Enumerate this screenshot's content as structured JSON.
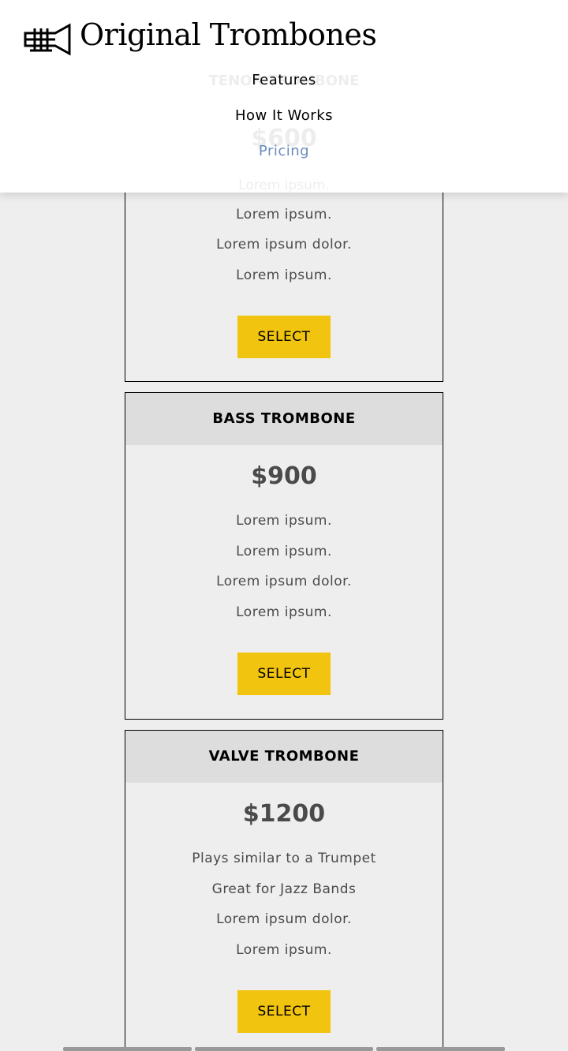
{
  "brand": {
    "name": "Original Trombones",
    "logo_icon": "trumpet-logo-icon"
  },
  "nav": {
    "items": [
      {
        "label": "Features",
        "active": false
      },
      {
        "label": "How It Works",
        "active": false
      },
      {
        "label": "Pricing",
        "active": true
      }
    ]
  },
  "pricing": {
    "cards": [
      {
        "title": "TENOR TROMBONE",
        "price": "$600",
        "features": [
          "Lorem ipsum.",
          "Lorem ipsum.",
          "Lorem ipsum dolor.",
          "Lorem ipsum."
        ],
        "button": "SELECT"
      },
      {
        "title": "BASS TROMBONE",
        "price": "$900",
        "features": [
          "Lorem ipsum.",
          "Lorem ipsum.",
          "Lorem ipsum dolor.",
          "Lorem ipsum."
        ],
        "button": "SELECT"
      },
      {
        "title": "VALVE TROMBONE",
        "price": "$1200",
        "features": [
          "Plays similar to a Trumpet",
          "Great for Jazz Bands",
          "Lorem ipsum dolor.",
          "Lorem ipsum."
        ],
        "button": "SELECT"
      }
    ]
  },
  "colors": {
    "accent": "#f1c40f",
    "active_nav": "#6b8cbf",
    "background": "#eeeeee",
    "card_header": "#dddddd"
  }
}
